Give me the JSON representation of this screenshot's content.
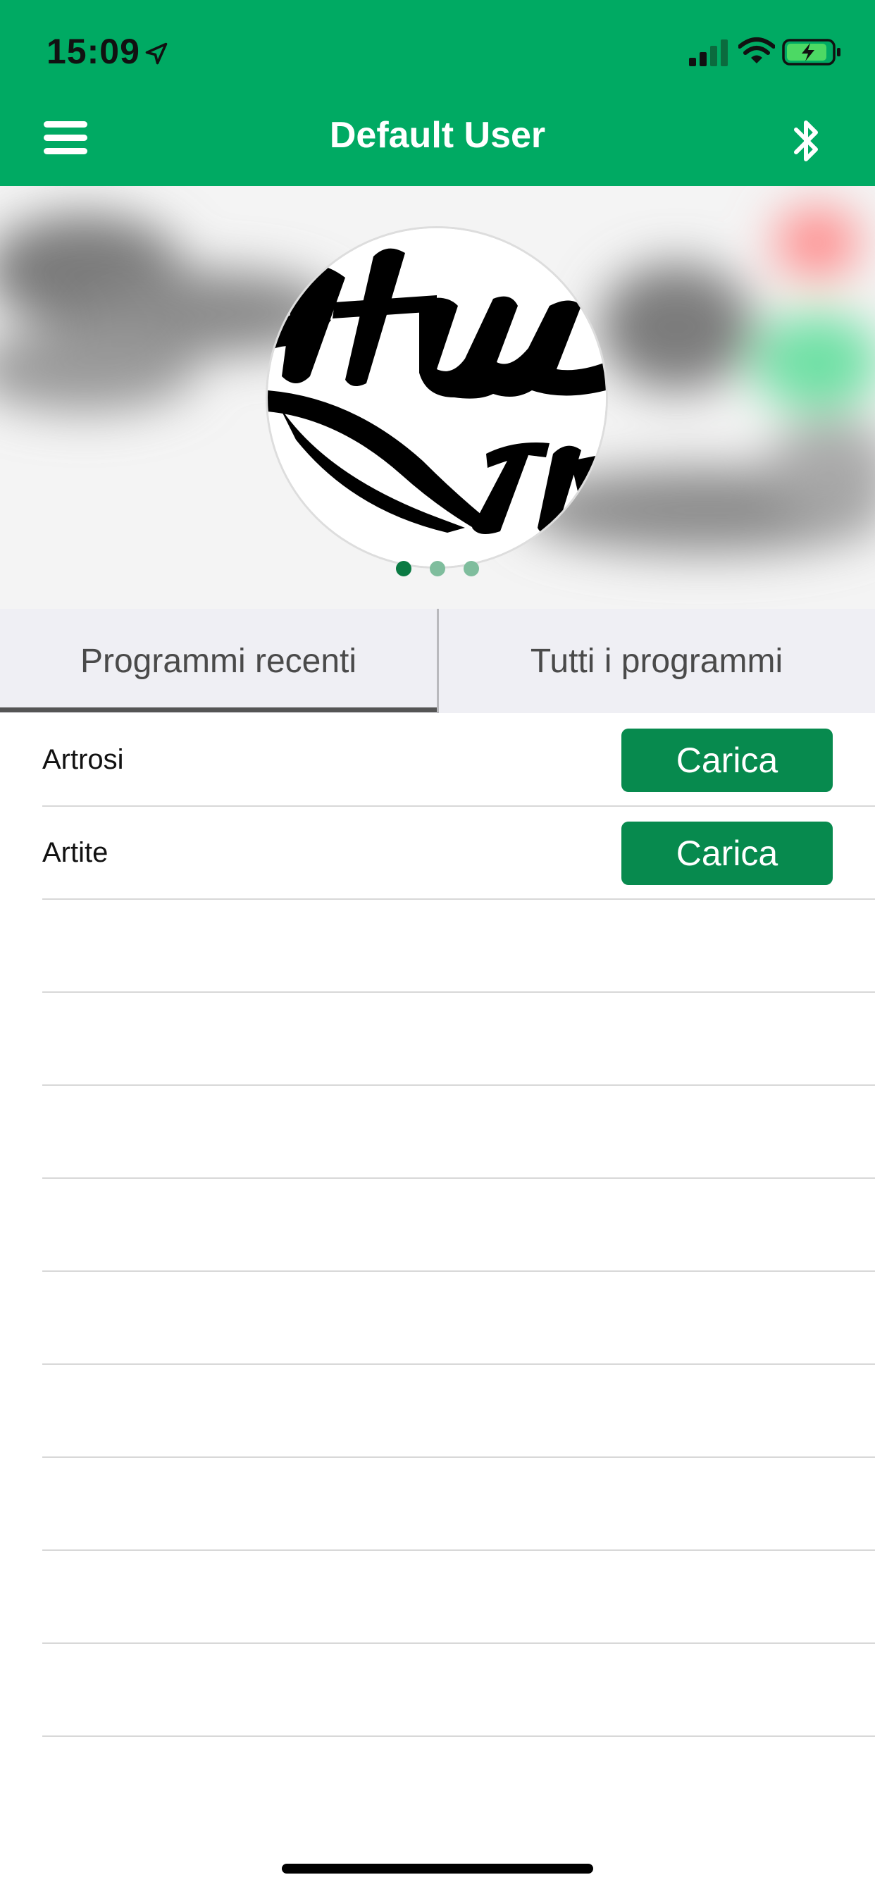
{
  "status_bar": {
    "time": "15:09"
  },
  "nav": {
    "title": "Default User"
  },
  "hero": {
    "page_count": 3,
    "active_page": 0,
    "colors": {
      "active_dot": "#0a7a43",
      "inactive_dot": "#7fbd9d"
    }
  },
  "tabs": [
    {
      "label": "Programmi recenti",
      "selected": true
    },
    {
      "label": "Tutti i programmi",
      "selected": false
    }
  ],
  "programs": [
    {
      "name": "Artrosi",
      "action": "Carica"
    },
    {
      "name": "Artite",
      "action": "Carica"
    }
  ],
  "colors": {
    "brand_green": "#00aa63",
    "button_green": "#078a4e",
    "tab_background": "#efeff4"
  }
}
